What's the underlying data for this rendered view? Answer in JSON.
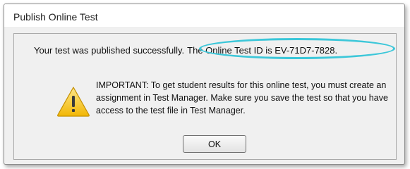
{
  "window": {
    "title": "Publish Online Test"
  },
  "message": {
    "success": "Your test was published successfully.",
    "test_id": "The Online Test ID is EV-71D7-7828.",
    "important": "IMPORTANT: To get student results for this online test, you must create an assignment in Test Manager. Make sure you save the test so that you have access to the test file in Test Manager."
  },
  "buttons": {
    "ok_label": "OK"
  },
  "icons": {
    "warning": "warning-triangle-icon"
  },
  "colors": {
    "highlight_ring": "#3cc7d9",
    "warning_yellow": "#f5c518"
  }
}
